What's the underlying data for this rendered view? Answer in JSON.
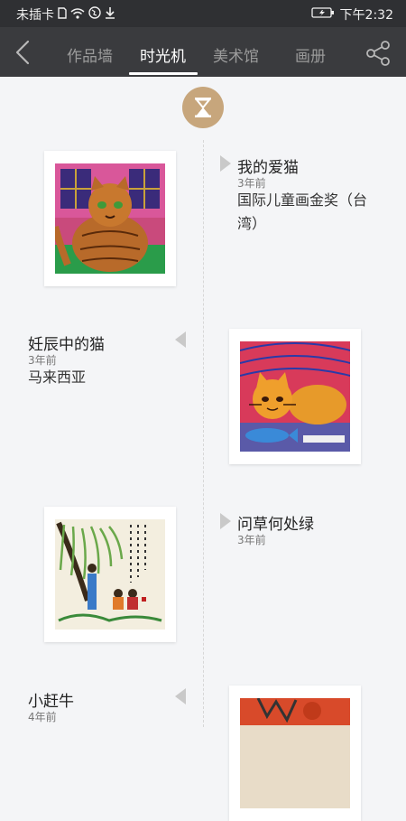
{
  "status_bar": {
    "carrier": "未插卡",
    "time": "下午2:32"
  },
  "nav": {
    "tabs": [
      "作品墙",
      "时光机",
      "美术馆",
      "画册"
    ],
    "active_tab": "时光机"
  },
  "timeline": [
    {
      "title": "我的爱猫",
      "time": "3年前",
      "desc": "国际儿童画金奖（台湾）"
    },
    {
      "title": "妊辰中的猫",
      "time": "3年前",
      "desc": "马来西亚"
    },
    {
      "title": "问草何处绿",
      "time": "3年前",
      "desc": ""
    },
    {
      "title": "小赶牛",
      "time": "4年前",
      "desc": ""
    }
  ],
  "colors": {
    "accent": "#c7a67c",
    "nav_bg": "#3a3b3e",
    "status_bg": "#2f3033",
    "page_bg": "#f4f5f7"
  }
}
